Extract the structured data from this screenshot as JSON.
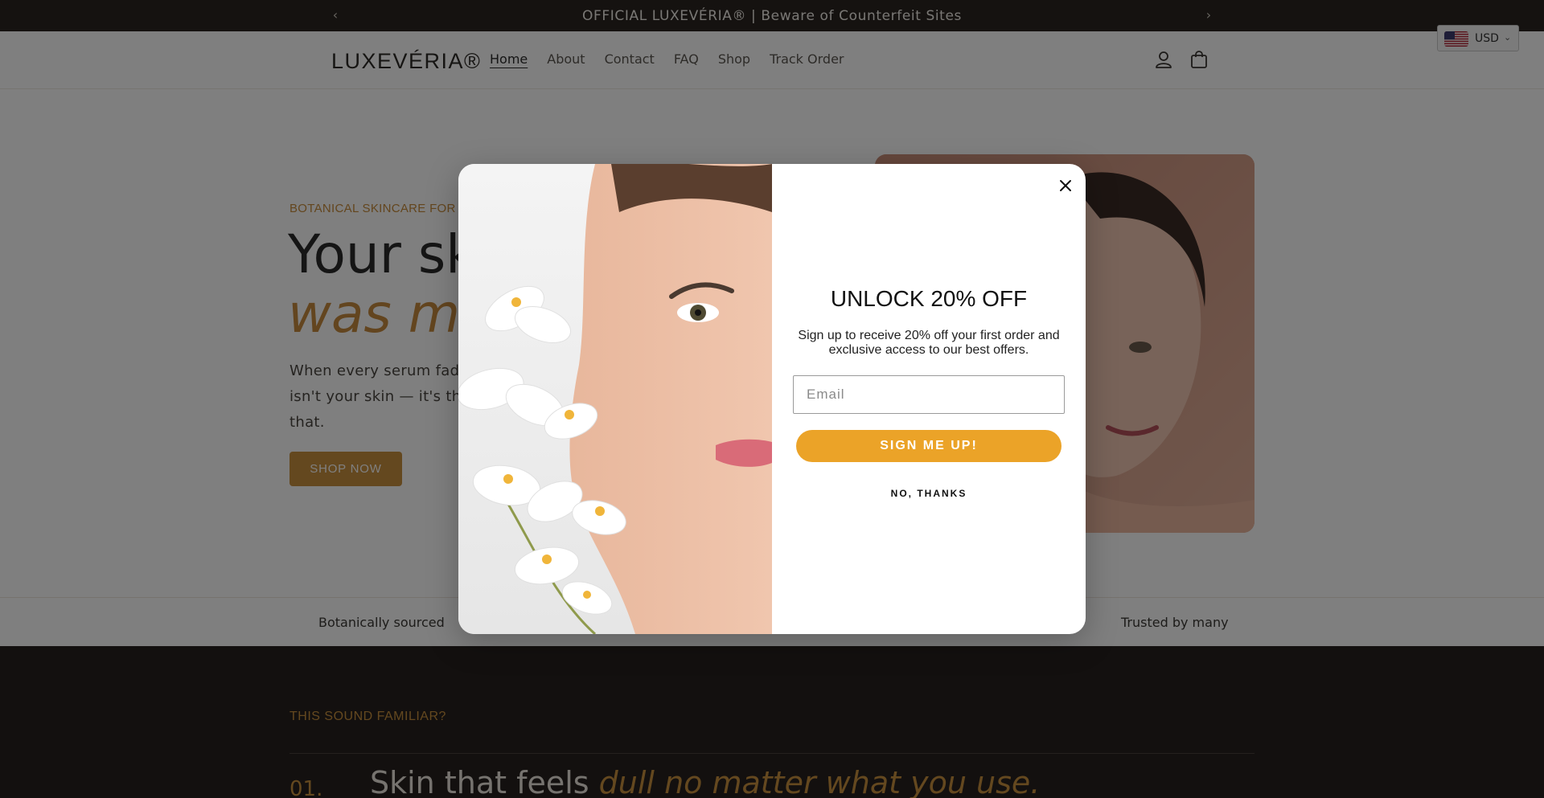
{
  "announcement": {
    "text": "OFFICIAL LUXEVÉRIA® | Beware of Counterfeit Sites",
    "prev_icon": "chevron-left-icon",
    "next_icon": "chevron-right-icon"
  },
  "header": {
    "logo": "LUXEVÉRIA®",
    "nav": [
      {
        "label": "Home",
        "active": true
      },
      {
        "label": "About"
      },
      {
        "label": "Contact"
      },
      {
        "label": "FAQ"
      },
      {
        "label": "Shop"
      },
      {
        "label": "Track Order"
      }
    ],
    "account_icon": "user-icon",
    "cart_icon": "shopping-bag-icon",
    "currency": {
      "code": "USD",
      "flag": "us-flag-icon"
    }
  },
  "hero": {
    "kicker": "BOTANICAL SKINCARE FOR",
    "heading_line1": "Your sk",
    "heading_line2": "was me",
    "body_lines": [
      "When every serum fade",
      "isn't your skin — it's the",
      "that."
    ],
    "cta": "SHOP NOW"
  },
  "trust": {
    "left": "Botanically sourced",
    "right": "Trusted by many"
  },
  "familiar": {
    "kicker": "THIS SOUND FAMILIAR?",
    "number": "01.",
    "text_plain": "Skin that feels ",
    "text_emph": "dull no matter what you use."
  },
  "popup": {
    "title": "UNLOCK 20% OFF",
    "subtitle": "Sign up to receive 20% off your first order and exclusive access to our best offers.",
    "email_placeholder": "Email",
    "submit": "SIGN ME UP!",
    "decline": "NO, THANKS",
    "close_icon": "close-icon"
  },
  "colors": {
    "announcement_bg": "#2a2521",
    "accent_gold": "#c9913f",
    "popup_button": "#eba328",
    "dark_section": "#26211e"
  }
}
